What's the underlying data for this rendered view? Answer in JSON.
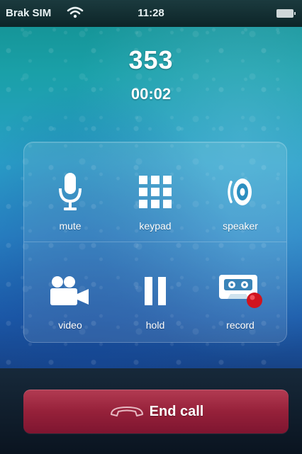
{
  "status_bar": {
    "carrier": "Brak SIM",
    "time": "11:28",
    "wifi_icon": "wifi-icon",
    "battery_icon": "battery-icon"
  },
  "call": {
    "caller": "353",
    "duration": "00:02"
  },
  "controls": [
    {
      "label": "mute",
      "icon": "microphone-icon"
    },
    {
      "label": "keypad",
      "icon": "keypad-icon"
    },
    {
      "label": "speaker",
      "icon": "speaker-icon"
    },
    {
      "label": "video",
      "icon": "video-camera-icon"
    },
    {
      "label": "hold",
      "icon": "pause-icon"
    },
    {
      "label": "record",
      "icon": "cassette-record-icon"
    }
  ],
  "end_call": {
    "label": "End call",
    "icon": "phone-hangup-icon",
    "color": "#96213a"
  },
  "colors": {
    "background_top": "#138f8f",
    "background_bottom": "#163d7d",
    "record_dot": "#d0141e"
  }
}
